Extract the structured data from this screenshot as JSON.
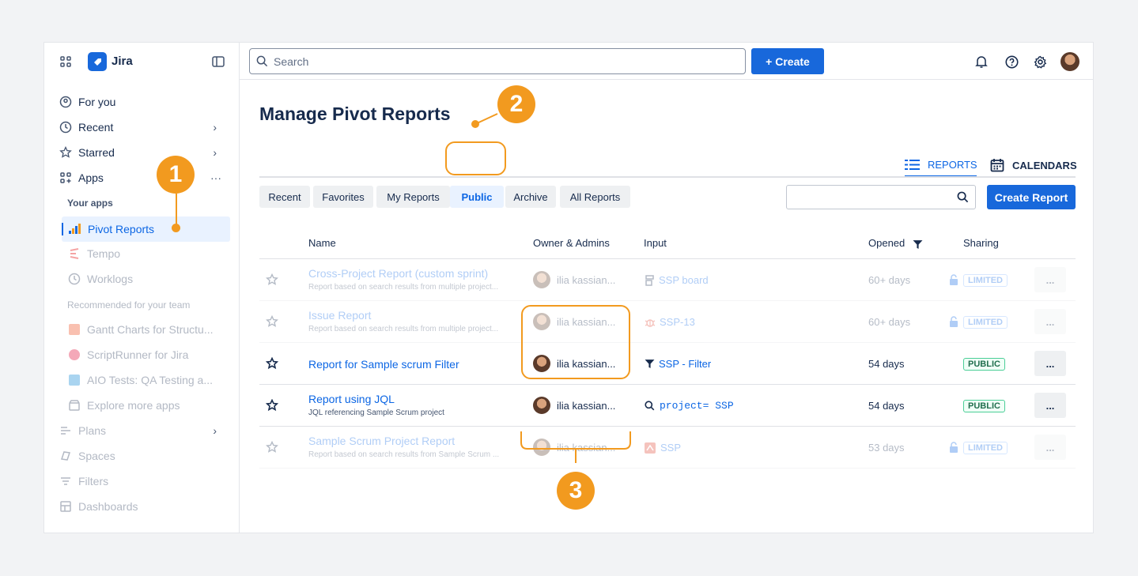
{
  "app": {
    "name": "Jira"
  },
  "topbar": {
    "search_placeholder": "Search",
    "create_label": "+ Create"
  },
  "sidebar": {
    "nav": [
      {
        "label": "For you"
      },
      {
        "label": "Recent"
      },
      {
        "label": "Starred"
      },
      {
        "label": "Apps"
      }
    ],
    "your_apps_title": "Your apps",
    "apps": [
      {
        "label": "Pivot Reports"
      },
      {
        "label": "Tempo"
      },
      {
        "label": "Worklogs"
      }
    ],
    "recommended_title": "Recommended for your team",
    "recommended": [
      {
        "label": "Gantt Charts for Structu..."
      },
      {
        "label": "ScriptRunner for Jira"
      },
      {
        "label": "AIO Tests: QA Testing a..."
      },
      {
        "label": "Explore more apps"
      }
    ],
    "bottom": [
      {
        "label": "Plans"
      },
      {
        "label": "Spaces"
      },
      {
        "label": "Filters"
      },
      {
        "label": "Dashboards"
      }
    ]
  },
  "page": {
    "title": "Manage Pivot Reports",
    "view_tabs": {
      "reports": "REPORTS",
      "calendars": "CALENDARS"
    },
    "tabs": [
      "Recent",
      "Favorites",
      "My Reports",
      "Public",
      "Archive",
      "All Reports"
    ],
    "active_tab": "Public",
    "create_report_label": "Create Report",
    "columns": {
      "name": "Name",
      "owner": "Owner & Admins",
      "input": "Input",
      "opened": "Opened",
      "sharing": "Sharing"
    }
  },
  "rows": [
    {
      "name": "Cross-Project Report (custom sprint)",
      "sub": "Report based on search results from multiple project...",
      "owner": "ilia kassian...",
      "input": "SSP board",
      "opened": "60+ days",
      "sharing": "LIMITED"
    },
    {
      "name": "Issue Report",
      "sub": "Report based on search results from multiple project...",
      "owner": "ilia kassian...",
      "input": "SSP-13",
      "opened": "60+ days",
      "sharing": "LIMITED"
    },
    {
      "name": "Report for Sample scrum Filter",
      "sub": "",
      "owner": "ilia kassian...",
      "input": "SSP - Filter",
      "opened": "54 days",
      "sharing": "PUBLIC"
    },
    {
      "name": "Report using JQL",
      "sub": "JQL referencing Sample Scrum project",
      "owner": "ilia kassian...",
      "input": "project= SSP",
      "opened": "54 days",
      "sharing": "PUBLIC"
    },
    {
      "name": "Sample Scrum Project Report",
      "sub": "Report based on search results from Sample Scrum ...",
      "owner": "ilia kassian...",
      "input": "SSP",
      "opened": "53 days",
      "sharing": "LIMITED"
    }
  ],
  "more_label": "...",
  "callouts": [
    "1",
    "2",
    "3"
  ],
  "colors": {
    "accent": "#0c66e4",
    "callout": "#f29a1f"
  }
}
